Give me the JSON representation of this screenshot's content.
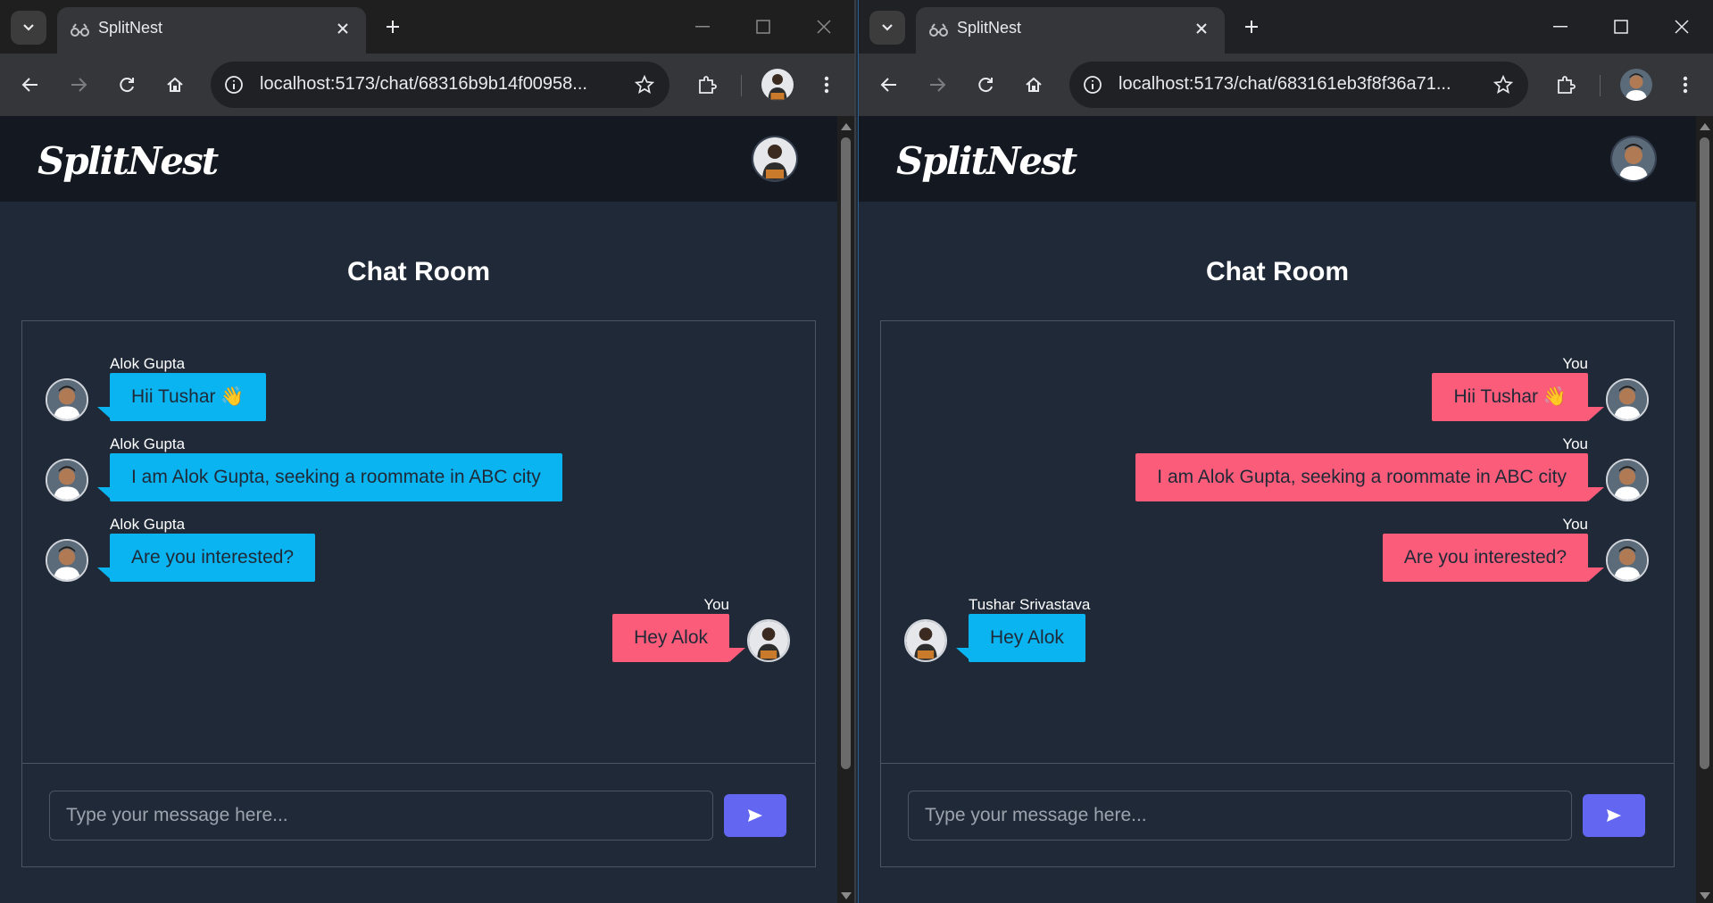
{
  "colors": {
    "incoming_bubble": "#0ab4f0",
    "outgoing_bubble": "#fb5c7a",
    "send_button": "#6366f1",
    "page_bg": "#1f2937",
    "header_bg": "#141820"
  },
  "left": {
    "tab_title": "SplitNest",
    "url": "localhost:5173/chat/68316b9b14f00958...",
    "logo": "SplitNest",
    "room_title": "Chat Room",
    "placeholder": "Type your message here...",
    "messages": [
      {
        "sender": "Alok Gupta",
        "text": "Hii Tushar 👋",
        "direction": "in"
      },
      {
        "sender": "Alok Gupta",
        "text": "I am Alok Gupta, seeking a roommate in ABC city",
        "direction": "in"
      },
      {
        "sender": "Alok Gupta",
        "text": "Are you interested?",
        "direction": "in"
      },
      {
        "sender": "You",
        "text": "Hey Alok",
        "direction": "out"
      }
    ]
  },
  "right": {
    "tab_title": "SplitNest",
    "url": "localhost:5173/chat/683161eb3f8f36a71...",
    "logo": "SplitNest",
    "room_title": "Chat Room",
    "placeholder": "Type your message here...",
    "messages": [
      {
        "sender": "You",
        "text": "Hii Tushar 👋",
        "direction": "out"
      },
      {
        "sender": "You",
        "text": "I am Alok Gupta, seeking a roommate in ABC city",
        "direction": "out"
      },
      {
        "sender": "You",
        "text": "Are you interested?",
        "direction": "out"
      },
      {
        "sender": "Tushar Srivastava",
        "text": "Hey Alok",
        "direction": "in"
      }
    ]
  }
}
